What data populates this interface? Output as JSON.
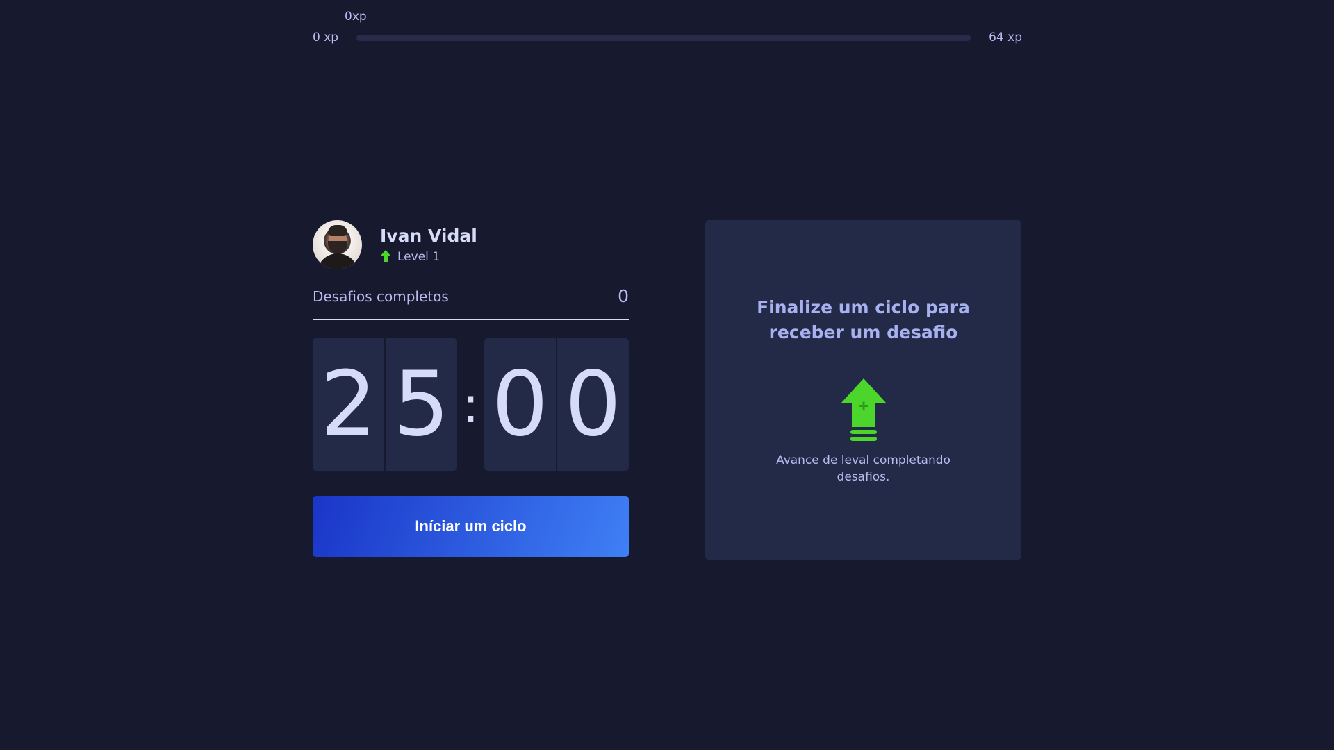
{
  "xp": {
    "min_label": "0 xp",
    "max_label": "64 xp",
    "current_label": "0xp",
    "progress_fraction": 0
  },
  "profile": {
    "name": "Ivan Vidal",
    "level_label": "Level 1"
  },
  "challenges": {
    "label": "Desafios completos",
    "count": "0"
  },
  "countdown": {
    "minutes_left": "2",
    "minutes_right": "5",
    "separator": ":",
    "seconds_left": "0",
    "seconds_right": "0"
  },
  "start_button": {
    "label": "Iníciar um ciclo"
  },
  "challenge_card": {
    "title": "Finalize um ciclo para receber um desafio",
    "description": "Avance de leval completando desafios."
  },
  "colors": {
    "background": "#171a2e",
    "panel": "#232a47",
    "accent_green": "#4cd62b",
    "button_start": "#1a35c8",
    "button_end": "#3f80f5",
    "text": "#b7bdf0"
  },
  "icons": {
    "level": "level-up-arrow-icon",
    "card": "level-up-arrow-icon"
  }
}
